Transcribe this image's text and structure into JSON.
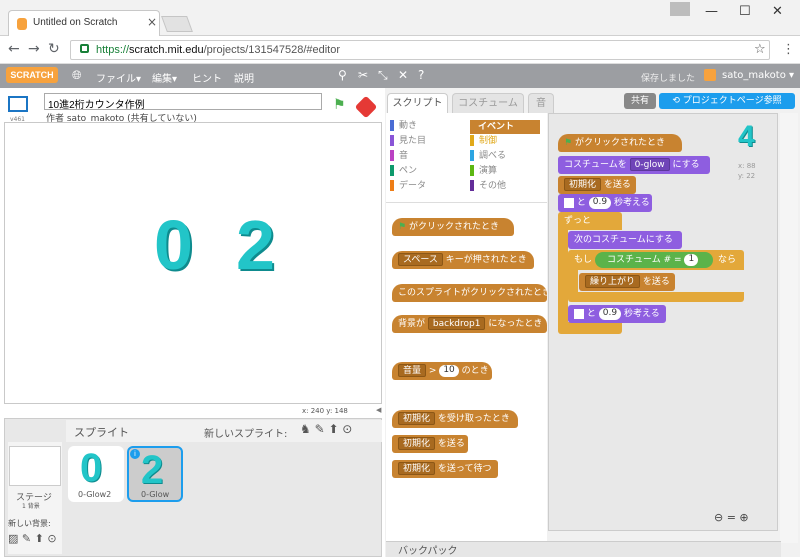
{
  "browser": {
    "tab_title": "Untitled on Scratch",
    "url_secure": "https://",
    "url_host": "scratch.mit.edu",
    "url_path": "/projects/131547528/#editor"
  },
  "menubar": {
    "logo": "SCRATCH",
    "file": "ファイル▾",
    "edit": "編集▾",
    "hint": "ヒント",
    "about": "説明",
    "saved": "保存しました",
    "user": "sato_makoto ▾"
  },
  "stage": {
    "version": "v461",
    "project_name": "10進2桁カウンタ作例",
    "author": "作者 sato_makoto (共有していない)",
    "digit_left": "0",
    "digit_right": "2",
    "coords": "x: 240  y: 148"
  },
  "sprites": {
    "header": "スプライト",
    "new_sprite": "新しいスプライト:",
    "stage_label": "ステージ",
    "stage_count": "1 背景",
    "new_backdrop": "新しい背景:",
    "items": [
      {
        "glyph": "0",
        "label": "0-Glow2"
      },
      {
        "glyph": "2",
        "label": "0-Glow"
      }
    ]
  },
  "tabs": {
    "scripts": "スクリプト",
    "costumes": "コスチューム",
    "sounds": "音",
    "share": "共有",
    "project_page": "プロジェクトページ参照"
  },
  "categories": {
    "left": [
      {
        "label": "動き",
        "color": "#4a6cd4"
      },
      {
        "label": "見た目",
        "color": "#8a55d7"
      },
      {
        "label": "音",
        "color": "#bb42c3"
      },
      {
        "label": "ペン",
        "color": "#0e9a6c"
      },
      {
        "label": "データ",
        "color": "#ee7d16"
      }
    ],
    "right": [
      {
        "label": "イベント",
        "color": "#c88330"
      },
      {
        "label": "制御",
        "color": "#e1a91a"
      },
      {
        "label": "調べる",
        "color": "#2ca5e2"
      },
      {
        "label": "演算",
        "color": "#5cb712"
      },
      {
        "label": "その他",
        "color": "#632d99"
      }
    ]
  },
  "palette": {
    "flag_clicked": "がクリックされたとき",
    "key_dd": "スペース",
    "key_rest": "キーが押されたとき",
    "sprite_clicked": "このスプライトがクリックされたとき",
    "backdrop_pre": "背景が",
    "backdrop_dd": "backdrop1",
    "backdrop_post": "になったとき",
    "loud_dd": "音量",
    "loud_gt": ">",
    "loud_val": "10",
    "loud_post": "のとき",
    "recv_dd": "初期化",
    "recv_post": "を受け取ったとき",
    "bcast_dd": "初期化",
    "bcast_post": "を送る",
    "bcastwait_dd": "初期化",
    "bcastwait_post": "を送って待つ"
  },
  "script": {
    "hat": "がクリックされたとき",
    "costume_pre": "コスチュームを",
    "costume_dd": "0-glow",
    "costume_post": "にする",
    "send_dd": "初期化",
    "send_post": "を送る",
    "think_pre": "と",
    "think_val": "0.9",
    "think_post": "秒考える",
    "forever": "ずっと",
    "next_costume": "次のコスチュームにする",
    "if": "もし",
    "cond_left": "コスチューム #",
    "cond_op": "=",
    "cond_val": "1",
    "then": "なら",
    "carry_dd": "繰り上がり",
    "carry_post": "を送る",
    "think2_pre": "と",
    "think2_val": "0.9",
    "think2_post": "秒考える",
    "sprite_glyph": "4",
    "x": "x: 88",
    "y": "y: 22"
  },
  "backpack": "バックパック",
  "zoom": "⊖ = ⊕"
}
